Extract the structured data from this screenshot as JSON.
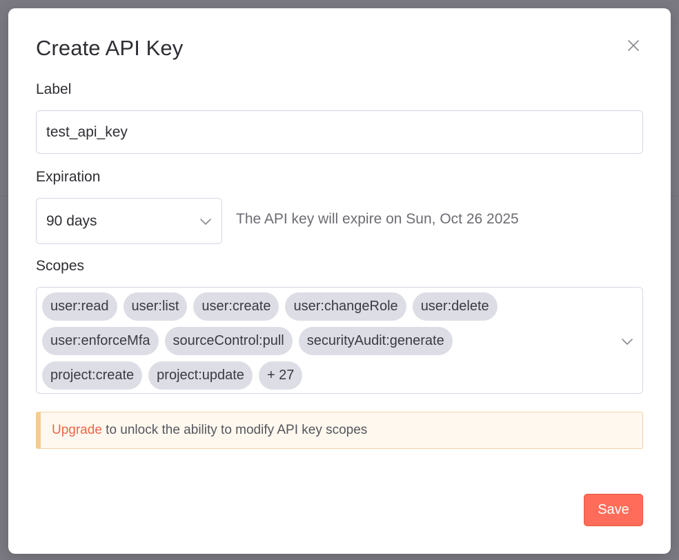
{
  "modal": {
    "title": "Create API Key",
    "close_icon": "close-icon"
  },
  "label_field": {
    "label": "Label",
    "value": "test_api_key"
  },
  "expiration": {
    "label": "Expiration",
    "selected": "90 days",
    "note": "The API key will expire on Sun, Oct 26 2025",
    "icon": "chevron-down-icon"
  },
  "scopes": {
    "label": "Scopes",
    "rows": [
      [
        "user:read",
        "user:list",
        "user:create",
        "user:changeRole",
        "user:delete"
      ],
      [
        "user:enforceMfa",
        "sourceControl:pull",
        "securityAudit:generate"
      ],
      [
        "project:create",
        "project:update",
        "+ 27"
      ]
    ],
    "icon": "chevron-down-icon"
  },
  "callout": {
    "link_text": "Upgrade",
    "text": " to unlock the ability to modify API key scopes",
    "accent_color": "#f5cc8e",
    "link_color": "#ef6449"
  },
  "actions": {
    "save_label": "Save",
    "save_color": "#ff6d5a"
  }
}
